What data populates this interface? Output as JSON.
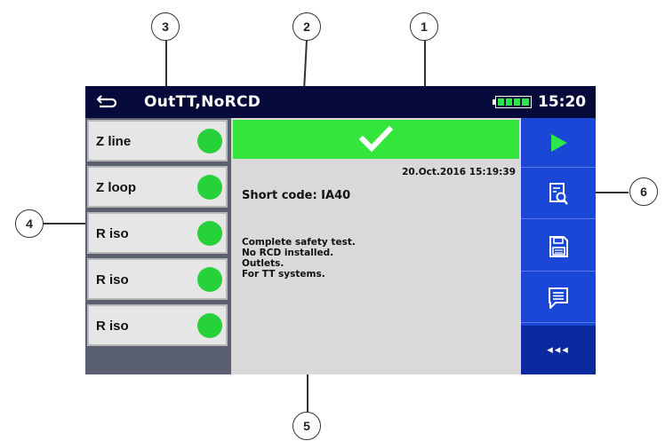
{
  "header": {
    "title": "OutTT,NoRCD",
    "clock": "15:20",
    "back_icon": "back-arrow-icon",
    "battery_icon": "battery-icon"
  },
  "tests": [
    {
      "label": "Z line",
      "status": "pass"
    },
    {
      "label": "Z loop",
      "status": "pass"
    },
    {
      "label": "R iso",
      "status": "pass"
    },
    {
      "label": "R iso",
      "status": "pass"
    },
    {
      "label": "R iso",
      "status": "pass"
    }
  ],
  "result": {
    "status": "pass",
    "status_icon": "checkmark-icon",
    "datetime": "20.Oct.2016 15:19:39",
    "short_code": "Short code: IA40",
    "description": [
      "Complete safety test.",
      "No RCD installed.",
      "Outlets.",
      "For TT systems."
    ]
  },
  "actions": {
    "start_icon": "play-icon",
    "view_icon": "view-results-icon",
    "save_icon": "save-icon",
    "comment_icon": "comment-icon",
    "more_label": "◂◂◂"
  },
  "callouts": [
    "1",
    "2",
    "3",
    "4",
    "5",
    "6"
  ],
  "colors": {
    "header_bg": "#050a3a",
    "pass_green": "#34e53e",
    "status_dot": "#27d13a",
    "action_blue": "#1a47d6",
    "panel_gray": "#d9d9d9"
  }
}
